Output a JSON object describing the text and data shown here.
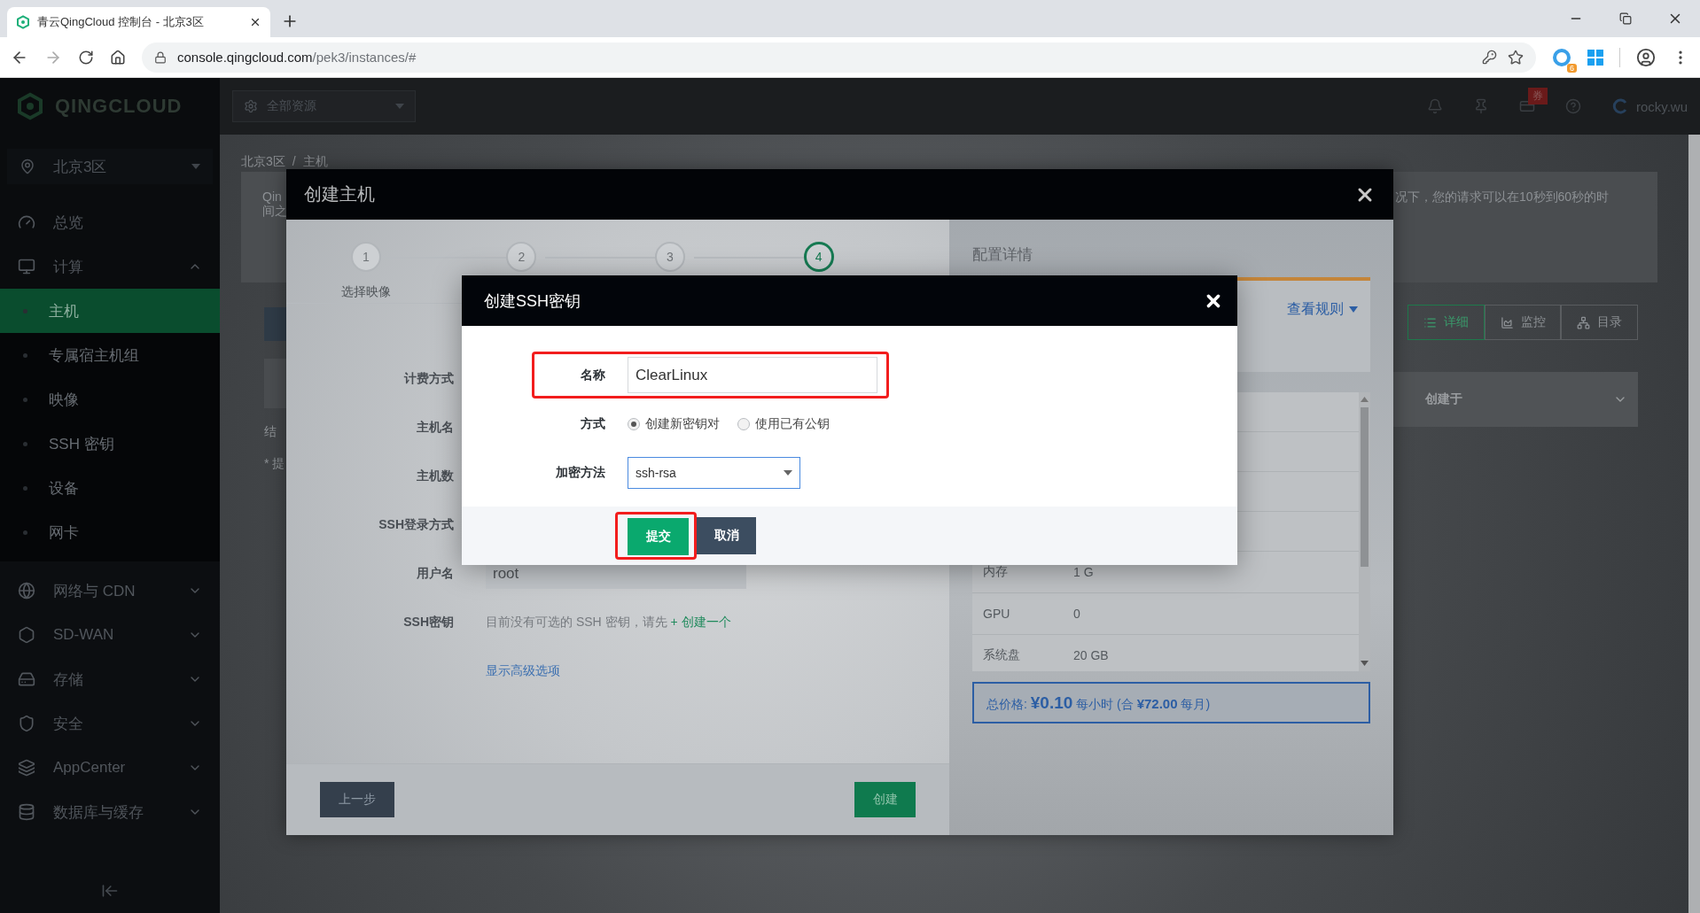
{
  "browser": {
    "tab": {
      "title": "青云QingCloud 控制台 - 北京3区"
    },
    "url": {
      "domain": "console.qingcloud.com",
      "path": "/pek3/instances/#"
    },
    "extension_badge": "6"
  },
  "topbar": {
    "logo": "QINGCLOUD",
    "resource_select": "全部资源",
    "coupon_badge": "券",
    "user": "rocky.wu"
  },
  "sidebar": {
    "region": "北京3区",
    "items": [
      {
        "kind": "link",
        "label": "总览"
      },
      {
        "kind": "group",
        "label": "计算",
        "expanded": true,
        "children": [
          {
            "label": "主机",
            "selected": true
          },
          {
            "label": "专属宿主机组",
            "selected": false
          },
          {
            "label": "映像",
            "selected": false
          },
          {
            "label": "SSH 密钥",
            "selected": false
          },
          {
            "label": "设备",
            "selected": false
          },
          {
            "label": "网卡",
            "selected": false
          }
        ]
      },
      {
        "kind": "group",
        "label": "网络与 CDN",
        "expanded": false
      },
      {
        "kind": "group",
        "label": "SD-WAN",
        "expanded": false
      },
      {
        "kind": "group",
        "label": "存储",
        "expanded": false
      },
      {
        "kind": "group",
        "label": "安全",
        "expanded": false
      },
      {
        "kind": "group",
        "label": "AppCenter",
        "expanded": false
      },
      {
        "kind": "group",
        "label": "数据库与缓存",
        "expanded": false
      }
    ]
  },
  "background": {
    "breadcrumb": {
      "items": [
        "北京3区",
        "主机"
      ],
      "separator": "/"
    },
    "notice_left": [
      "Qin",
      "间之"
    ],
    "notice_right": "况下，您的请求可以在10秒到60秒的时",
    "result_left": [
      "结",
      "* 提"
    ],
    "view_tabs": [
      {
        "label": "详细",
        "selected": true
      },
      {
        "label": "监控",
        "selected": false
      },
      {
        "label": "目录",
        "selected": false
      }
    ],
    "sort_select": "创建于"
  },
  "create_instance": {
    "title": "创建主机",
    "steps": [
      {
        "number": "1",
        "label": "选择映像",
        "selected": false
      },
      {
        "number": "2",
        "selected": false
      },
      {
        "number": "3",
        "selected": false
      },
      {
        "number": "4",
        "selected": true
      }
    ],
    "form": {
      "labels": [
        "计费方式",
        "主机名",
        "主机数",
        "SSH登录方式"
      ],
      "username": {
        "label": "用户名",
        "value": "root"
      },
      "ssh_key": {
        "label": "SSH密钥",
        "text": "目前没有可选的 SSH 密钥，请先",
        "link": "+ 创建一个"
      },
      "advanced_link": "显示高级选项"
    },
    "buttons": {
      "back": "上一步",
      "create": "创建"
    },
    "summary": {
      "title": "配置详情",
      "rules_link": "查看规则",
      "rows": [
        {
          "name": "内存",
          "value": "1 G"
        },
        {
          "name": "GPU",
          "value": "0"
        },
        {
          "name": "系统盘",
          "value": "20 GB"
        }
      ],
      "price": "总价格:  **¥0.10** 每小时 (合 **¥72.00** 每月)"
    }
  },
  "ssh_dialog": {
    "title": "创建SSH密钥",
    "name": {
      "label": "名称",
      "value": "ClearLinux",
      "highlighted": true
    },
    "method": {
      "label": "方式",
      "options": [
        {
          "label": "创建新密钥对",
          "selected": true
        },
        {
          "label": "使用已有公钥",
          "selected": false
        }
      ]
    },
    "encryption": {
      "label": "加密方法",
      "value": "ssh-rsa"
    },
    "submit": {
      "label": "提交",
      "highlighted": true
    },
    "cancel": "取消"
  }
}
